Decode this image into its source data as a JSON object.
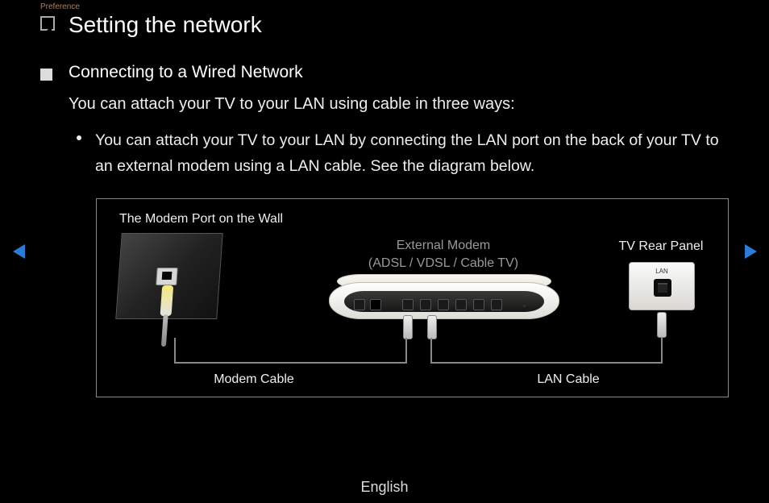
{
  "breadcrumb": "Preference",
  "title": "Setting the network",
  "subtitle": "Connecting to a Wired Network",
  "intro": "You can attach your TV to your LAN using cable in three ways:",
  "bullet": "You can attach your TV to your LAN by connecting the LAN port on the back of your TV to an external modem using a LAN cable. See the diagram below.",
  "diagram": {
    "wall_label": "The Modem Port on the Wall",
    "modem_label_line1": "External Modem",
    "modem_label_line2": "(ADSL / VDSL / Cable TV)",
    "tv_label": "TV Rear Panel",
    "modem_cable_label": "Modem Cable",
    "lan_cable_label": "LAN Cable",
    "lan_port_text": "LAN"
  },
  "footer_language": "English"
}
